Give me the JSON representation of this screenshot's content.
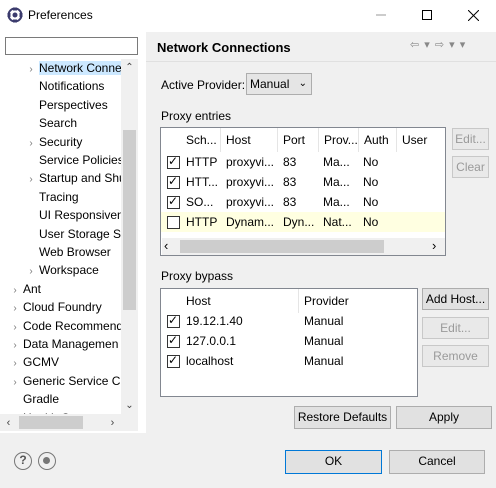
{
  "window": {
    "title": "Preferences"
  },
  "filter": {
    "value": "",
    "placeholder": ""
  },
  "tree": {
    "items": [
      {
        "label": "Network Conne",
        "twisty": "›",
        "indent": 1,
        "selected": true
      },
      {
        "label": "Notifications",
        "twisty": "",
        "indent": 1
      },
      {
        "label": "Perspectives",
        "twisty": "",
        "indent": 1
      },
      {
        "label": "Search",
        "twisty": "",
        "indent": 1
      },
      {
        "label": "Security",
        "twisty": "›",
        "indent": 1
      },
      {
        "label": "Service Policies",
        "twisty": "",
        "indent": 1
      },
      {
        "label": "Startup and Shu",
        "twisty": "›",
        "indent": 1
      },
      {
        "label": "Tracing",
        "twisty": "",
        "indent": 1
      },
      {
        "label": "UI Responsivene",
        "twisty": "",
        "indent": 1
      },
      {
        "label": "User Storage Se",
        "twisty": "",
        "indent": 1
      },
      {
        "label": "Web Browser",
        "twisty": "",
        "indent": 1
      },
      {
        "label": "Workspace",
        "twisty": "›",
        "indent": 1
      },
      {
        "label": "Ant",
        "twisty": "›",
        "indent": 0
      },
      {
        "label": "Cloud Foundry",
        "twisty": "›",
        "indent": 0
      },
      {
        "label": "Code Recommend",
        "twisty": "›",
        "indent": 0
      },
      {
        "label": "Data Managemen",
        "twisty": "›",
        "indent": 0
      },
      {
        "label": "GCMV",
        "twisty": "›",
        "indent": 0
      },
      {
        "label": "Generic Service Cli",
        "twisty": "›",
        "indent": 0
      },
      {
        "label": "Gradle",
        "twisty": "",
        "indent": 0
      },
      {
        "label": "Health Center",
        "twisty": "›",
        "indent": 0
      }
    ]
  },
  "page": {
    "title": "Network Connections",
    "nav_icons": "⇦ ▾ ⇨ ▾ ▾"
  },
  "provider": {
    "label": "Active Provider:",
    "value": "Manual"
  },
  "proxy_entries": {
    "label": "Proxy entries",
    "columns": [
      "Sch...",
      "Host",
      "Port",
      "Prov...",
      "Auth",
      "User"
    ],
    "rows": [
      {
        "checked": true,
        "schema": "HTTP",
        "host": "proxyvi...",
        "port": "83",
        "provider": "Ma...",
        "auth": "No",
        "user": ""
      },
      {
        "checked": true,
        "schema": "HTT...",
        "host": "proxyvi...",
        "port": "83",
        "provider": "Ma...",
        "auth": "No",
        "user": ""
      },
      {
        "checked": true,
        "schema": "SO...",
        "host": "proxyvi...",
        "port": "83",
        "provider": "Ma...",
        "auth": "No",
        "user": ""
      },
      {
        "checked": false,
        "schema": "HTTP",
        "host": "Dynam...",
        "port": "Dyn...",
        "provider": "Nat...",
        "auth": "No",
        "user": ""
      }
    ],
    "buttons": {
      "edit": "Edit...",
      "clear": "Clear"
    }
  },
  "proxy_bypass": {
    "label": "Proxy bypass",
    "columns": [
      "Host",
      "Provider"
    ],
    "rows": [
      {
        "checked": true,
        "host": "19.12.1.40",
        "provider": "Manual"
      },
      {
        "checked": true,
        "host": "127.0.0.1",
        "provider": "Manual"
      },
      {
        "checked": true,
        "host": "localhost",
        "provider": "Manual"
      }
    ],
    "buttons": {
      "add": "Add Host...",
      "edit": "Edit...",
      "remove": "Remove"
    }
  },
  "actions": {
    "restore_defaults": "Restore Defaults",
    "apply": "Apply"
  },
  "footer": {
    "ok": "OK",
    "cancel": "Cancel",
    "help_glyph": "?"
  }
}
